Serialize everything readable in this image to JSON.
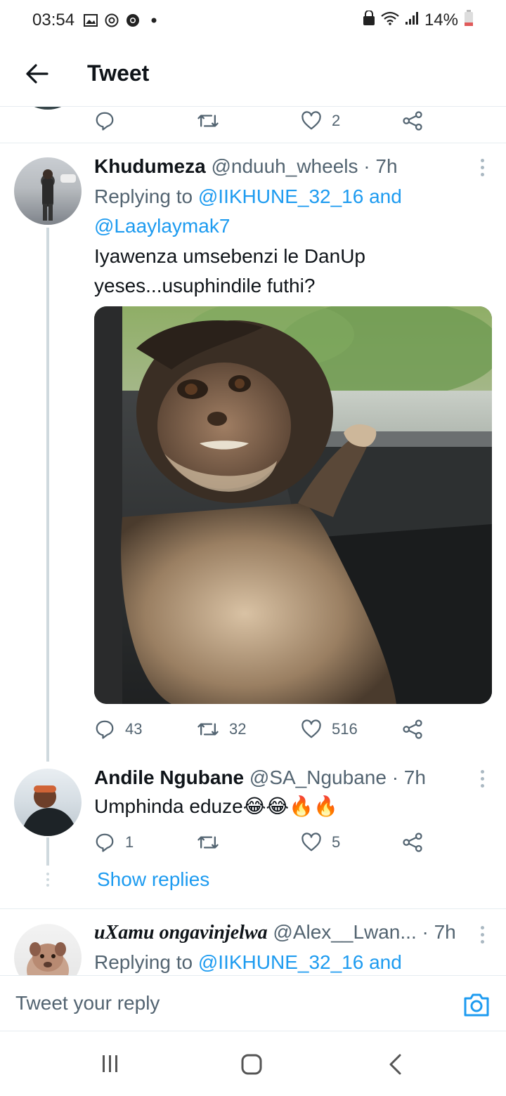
{
  "status_bar": {
    "time": "03:54",
    "battery": "14%",
    "icons": [
      "gallery-icon",
      "instagram-icon",
      "chrome-icon",
      "dot-icon",
      "lock-icon",
      "wifi-icon",
      "signal-icon",
      "battery-icon"
    ]
  },
  "header": {
    "title": "Tweet",
    "back_icon": "arrow-left-icon"
  },
  "top_actions": {
    "like_count": "2"
  },
  "tweets": [
    {
      "name": "Khudumeza",
      "handle": "@nduuh_wheels",
      "time": "· 7h",
      "replying_prefix": "Replying to ",
      "replying_mention_1": "@IIKHUNE_32_16",
      "replying_and": " and",
      "replying_mention_2": "@Laaylaymak7",
      "text_line_1": "Iyawenza umsebenzi le DanUp",
      "text_line_2": "yeses...usuphindile futhi?",
      "reply_count": "43",
      "retweet_count": "32",
      "like_count": "516"
    },
    {
      "name": "Andile Ngubane",
      "handle": "@SA_Ngubane",
      "time": "· 7h",
      "text": "Umphinda eduze😂😂🔥🔥",
      "reply_count": "1",
      "retweet_count": "",
      "like_count": "5",
      "show_replies": "Show replies"
    },
    {
      "name": "uXamu ongavinjelwa",
      "handle": "@Alex__Lwan...",
      "time": "· 7h",
      "replying_prefix": "Replying to ",
      "replying_mention_1": "@IIKHUNE_32_16",
      "replying_and": " and"
    }
  ],
  "composer": {
    "placeholder": "Tweet your reply"
  },
  "colors": {
    "accent": "#1d9bf0",
    "secondary_text": "#536471",
    "divider": "#e6ecf0"
  }
}
